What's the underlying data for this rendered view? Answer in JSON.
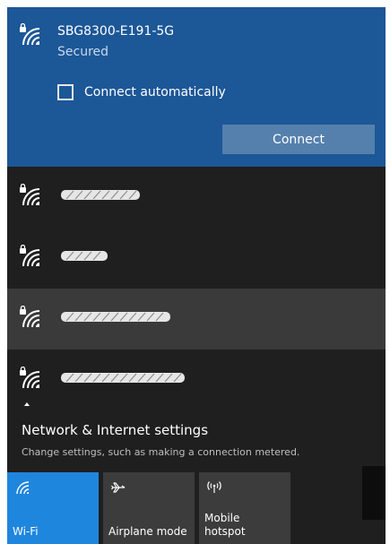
{
  "selected_network": {
    "name": "SBG8300-E191-5G",
    "status": "Secured",
    "auto_connect_label": "Connect automatically",
    "auto_connect_checked": false,
    "connect_label": "Connect"
  },
  "networks": [
    {
      "name": "",
      "redacted": true
    },
    {
      "name": "",
      "redacted": true
    },
    {
      "name": "",
      "redacted": true
    },
    {
      "name": "",
      "redacted": true
    }
  ],
  "settings": {
    "title": "Network & Internet settings",
    "description": "Change settings, such as making a connection metered."
  },
  "quick_actions": [
    {
      "label": "Wi-Fi",
      "icon": "wifi-icon",
      "active": true
    },
    {
      "label": "Airplane mode",
      "icon": "airplane-icon",
      "active": false
    },
    {
      "label": "Mobile hotspot",
      "icon": "hotspot-icon",
      "active": false
    }
  ],
  "colors": {
    "accent": "#1c5797",
    "tile_active": "#1f86dd",
    "background": "#1f1f1f",
    "row_hover": "#3a3a3a"
  }
}
